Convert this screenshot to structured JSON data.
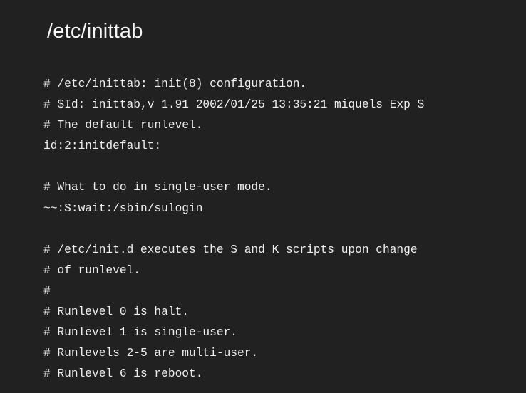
{
  "slide": {
    "title": "/etc/inittab",
    "lines": [
      "# /etc/inittab: init(8) configuration.",
      "# $Id: inittab,v 1.91 2002/01/25 13:35:21 miquels Exp $",
      "# The default runlevel.",
      "id:2:initdefault:",
      "",
      "# What to do in single-user mode.",
      "~~:S:wait:/sbin/sulogin",
      "",
      "# /etc/init.d executes the S and K scripts upon change",
      "# of runlevel.",
      "#",
      "# Runlevel 0 is halt.",
      "# Runlevel 1 is single-user.",
      "# Runlevels 2-5 are multi-user.",
      "# Runlevel 6 is reboot."
    ]
  },
  "colors": {
    "background": "#212121",
    "text": "#eeeeee"
  }
}
